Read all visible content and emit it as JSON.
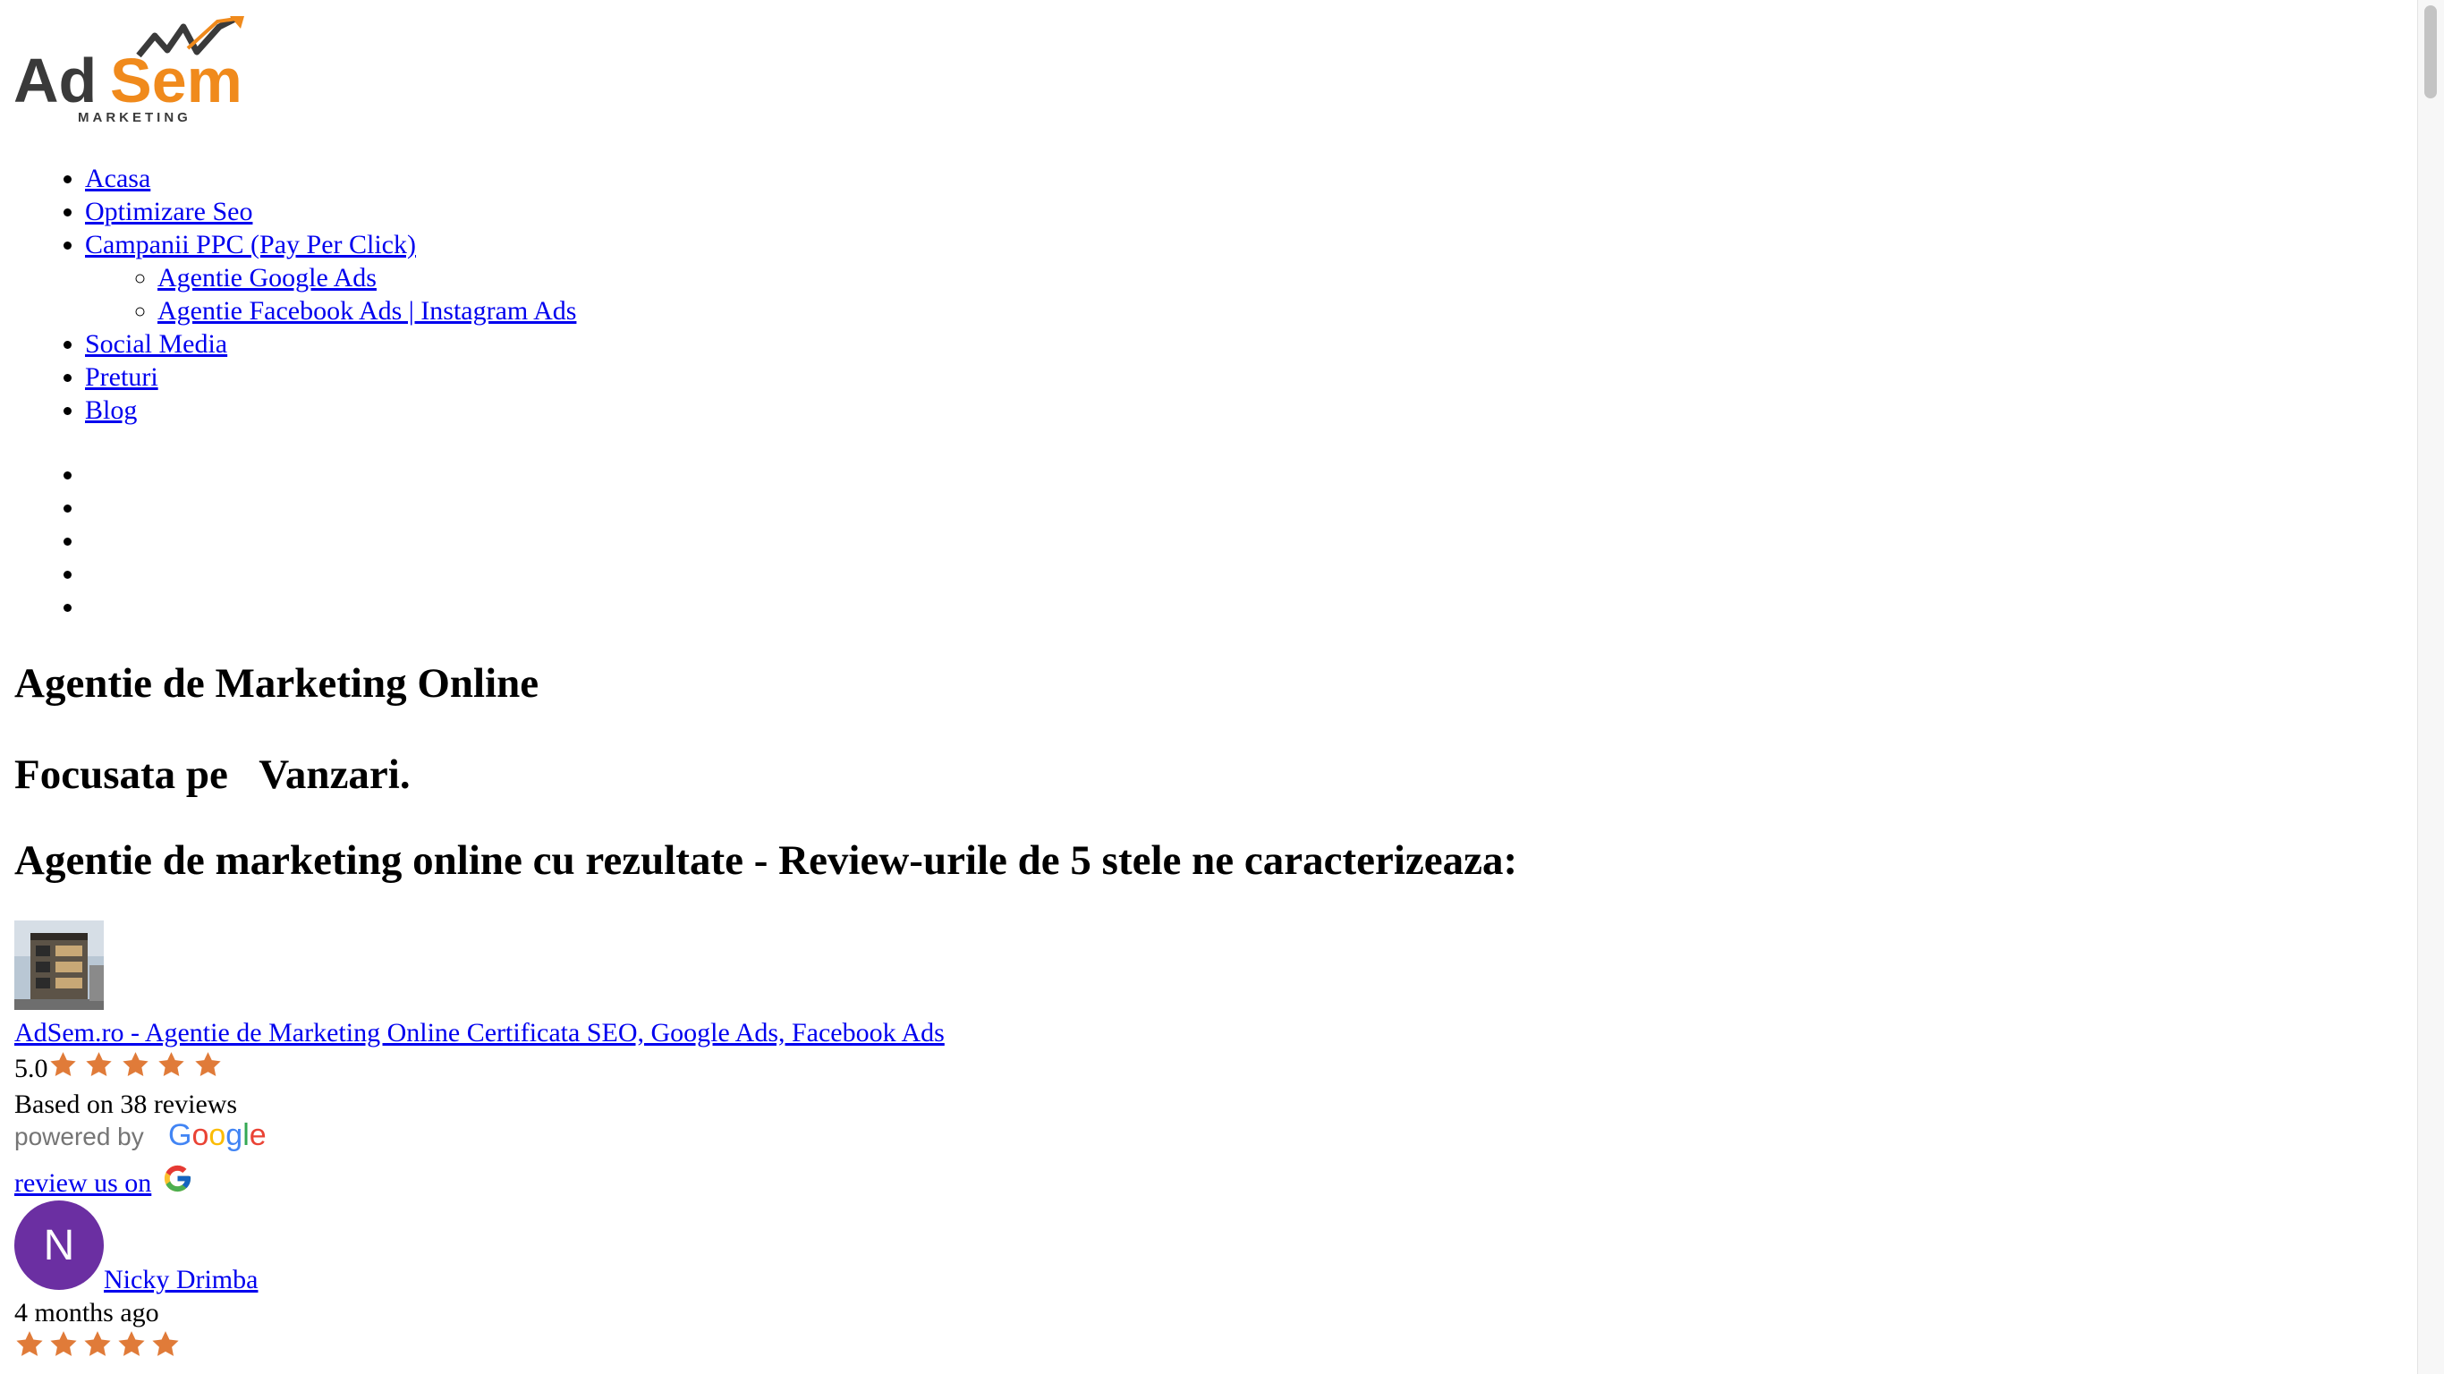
{
  "logo": {
    "part1": "Ad",
    "part2": "Sem",
    "tagline": "MARKETING",
    "colors": {
      "dark": "#3a3a3a",
      "accent": "#f08a1c"
    }
  },
  "nav": {
    "items": [
      {
        "label": "Acasa"
      },
      {
        "label": "Optimizare Seo"
      },
      {
        "label": "Campanii PPC (Pay Per Click)"
      },
      {
        "label": "Social Media"
      },
      {
        "label": "Preturi"
      },
      {
        "label": "Blog"
      }
    ],
    "submenu": [
      {
        "label": "Agentie Google Ads"
      },
      {
        "label": "Agentie Facebook Ads | Instagram Ads"
      }
    ],
    "empty_items_count": 5
  },
  "hero": {
    "title": "Agentie de Marketing Online",
    "subtitle": "Focusata pe   Vanzari.",
    "reviews_heading": "Agentie de marketing online cu rezultate - Review-urile de 5 stele ne caracterizeaza:"
  },
  "business": {
    "name": "AdSem.ro - Agentie de Marketing Online Certificata SEO, Google Ads, Facebook Ads",
    "rating": "5.0",
    "stars": 5,
    "based_on": "Based on 38 reviews",
    "powered_by": "powered by",
    "powered_brand": "Google",
    "review_us": "review us on",
    "star_color": "#e07b39"
  },
  "review": {
    "avatar_letter": "N",
    "avatar_color": "#6b2fa2",
    "reviewer": "Nicky Drimba",
    "time_ago": "4 months ago",
    "stars": 5
  },
  "icons": {
    "logo": "adsem-logo",
    "star": "star-icon",
    "google": "google-g-icon",
    "photo": "building-photo"
  }
}
